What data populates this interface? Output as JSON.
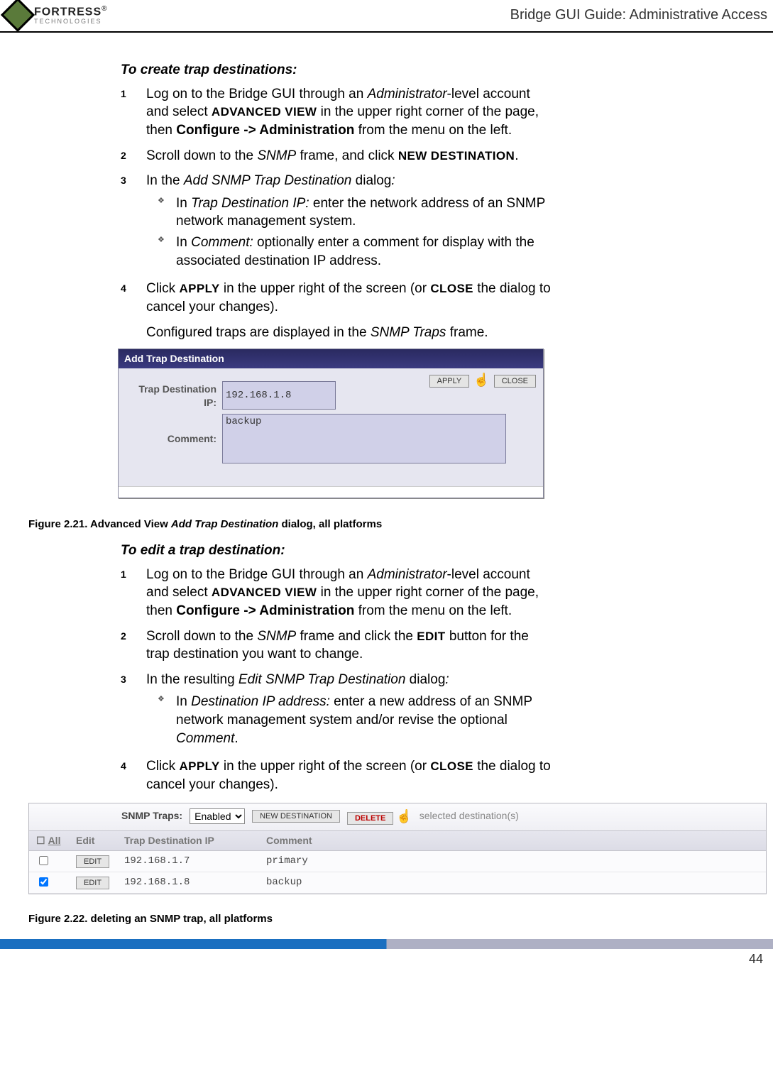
{
  "header": {
    "brand_main": "FORTRESS",
    "brand_sub": "TECHNOLOGIES",
    "right": "Bridge GUI Guide: Administrative Access"
  },
  "section1": {
    "title": "To create trap destinations:",
    "steps": [
      {
        "num": "1",
        "pre": "Log on to the Bridge GUI through an ",
        "it1": "Administrator",
        "mid1": "-level account and select ",
        "sc1": "ADVANCED VIEW",
        "mid2": " in the upper right corner of the page, then ",
        "bold1": "Configure -> Administration",
        "post": " from the menu on the left."
      },
      {
        "num": "2",
        "pre": "Scroll down to the ",
        "it1": "SNMP",
        "mid1": " frame, and click ",
        "sc1": "NEW DESTINATION",
        "post": "."
      },
      {
        "num": "3",
        "pre": "In the ",
        "it1": "Add SNMP Trap Destination",
        "mid1": " dialog",
        "it2": ":",
        "sub": [
          {
            "pre": "In ",
            "it1": "Trap Destination IP:",
            "post": " enter the network address of an SNMP network management system."
          },
          {
            "pre": "In ",
            "it1": "Comment:",
            "post": " optionally enter a comment for display with the associated destination IP address."
          }
        ]
      },
      {
        "num": "4",
        "pre": "Click ",
        "sc1": "APPLY",
        "mid1": " in the upper right of the screen (or ",
        "sc2": "CLOSE",
        "post": " the dialog to cancel your changes)."
      }
    ],
    "trail": "Configured traps are displayed in the ",
    "trail_it": "SNMP Traps",
    "trail_post": " frame."
  },
  "dialog": {
    "title": "Add Trap Destination",
    "apply": "APPLY",
    "close": "CLOSE",
    "label_ip": "Trap Destination IP:",
    "val_ip": "192.168.1.8",
    "label_comment": "Comment:",
    "val_comment": "backup"
  },
  "fig1": {
    "pre": "Figure 2.21. Advanced View ",
    "it": "Add Trap Destination",
    "post": " dialog, all platforms"
  },
  "section2": {
    "title": "To edit a trap destination:",
    "steps": [
      {
        "num": "1",
        "pre": "Log on to the Bridge GUI through an ",
        "it1": "Administrator",
        "mid1": "-level account and select ",
        "sc1": "ADVANCED VIEW",
        "mid2": " in the upper right corner of the page, then ",
        "bold1": "Configure -> Administration",
        "post": " from the menu on the left."
      },
      {
        "num": "2",
        "pre": "Scroll down to the ",
        "it1": "SNMP",
        "mid1": " frame and click the ",
        "sc1": "EDIT",
        "post": " button for the trap destination you want to change."
      },
      {
        "num": "3",
        "pre": "In the resulting ",
        "it1": "Edit SNMP Trap Destination",
        "mid1": " dialog",
        "it2": ":",
        "sub": [
          {
            "pre": "In ",
            "it1": "Destination IP address:",
            "post": " enter a new address of an SNMP network management system and/or revise the optional ",
            "it2": "Comment",
            "post2": "."
          }
        ]
      },
      {
        "num": "4",
        "pre": "Click ",
        "sc1": "APPLY",
        "mid1": " in the upper right of the screen (or ",
        "sc2": "CLOSE",
        "post": " the dialog to cancel your changes)."
      }
    ]
  },
  "traps": {
    "label": "SNMP Traps:",
    "sel_value": "Enabled",
    "btn_new": "NEW DESTINATION",
    "btn_del": "DELETE",
    "sel_dest": "selected destination(s)",
    "hdr_all": "All",
    "hdr_edit": "Edit",
    "hdr_ip": "Trap Destination IP",
    "hdr_comment": "Comment",
    "rows": [
      {
        "checked": false,
        "btn": "EDIT",
        "ip": "192.168.1.7",
        "comment": "primary"
      },
      {
        "checked": true,
        "btn": "EDIT",
        "ip": "192.168.1.8",
        "comment": "backup"
      }
    ]
  },
  "fig2": {
    "text": "Figure 2.22. deleting an SNMP trap, all platforms"
  },
  "page_number": "44"
}
